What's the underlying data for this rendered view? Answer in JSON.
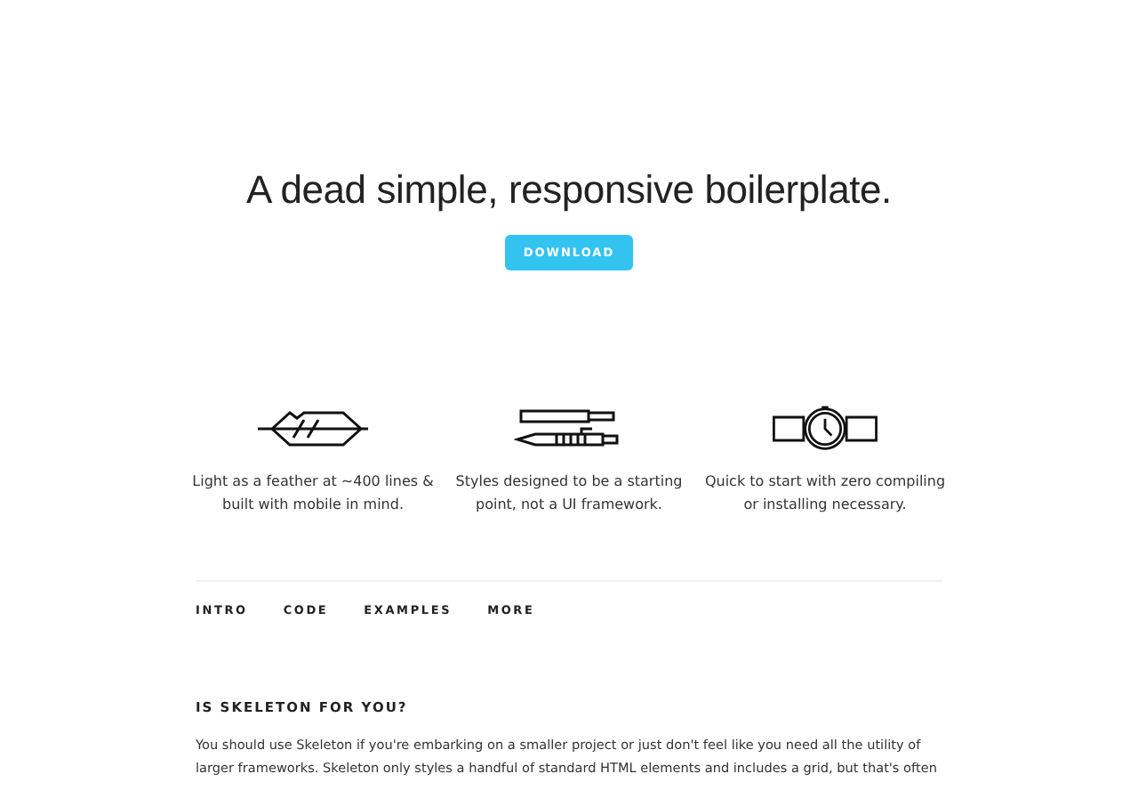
{
  "hero": {
    "title": "A dead simple, responsive boilerplate.",
    "button": "DOWNLOAD"
  },
  "features": [
    {
      "kind": "feather",
      "lines": [
        "Light as a feather at ~400 lines &",
        "built with mobile in mind."
      ]
    },
    {
      "kind": "pens",
      "lines": [
        "Styles designed to be a starting",
        "point, not a UI framework."
      ]
    },
    {
      "kind": "watch",
      "lines": [
        "Quick to start with zero compiling",
        "or installing necessary."
      ]
    }
  ],
  "nav": [
    "INTRO",
    "CODE",
    "EXAMPLES",
    "MORE"
  ],
  "section": {
    "heading": "IS SKELETON FOR YOU?",
    "paragraph_lines": [
      "You should use Skeleton if you're embarking on a smaller project or just don't feel like you need all the utility of",
      "larger frameworks. Skeleton only styles a handful of standard HTML elements and includes a grid, but that's often"
    ]
  }
}
